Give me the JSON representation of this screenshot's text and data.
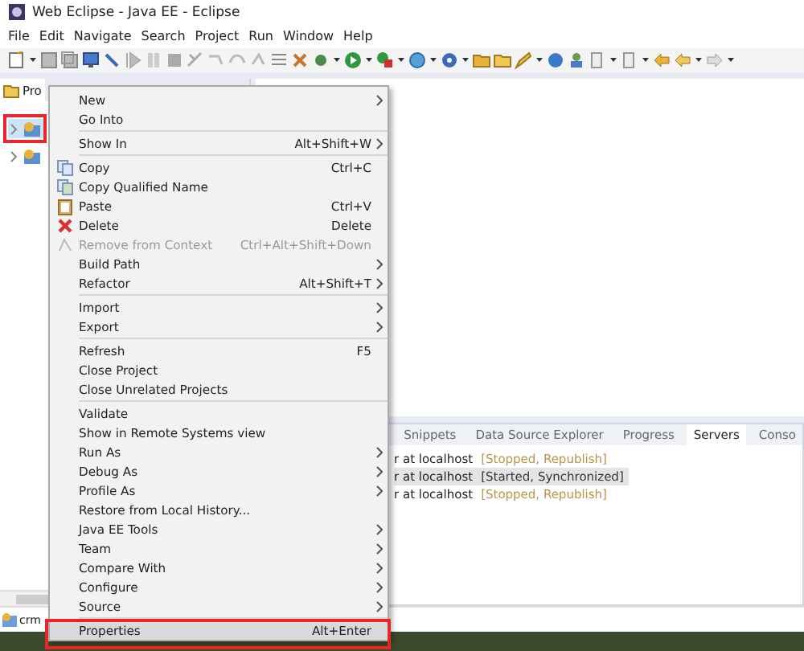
{
  "window": {
    "title": "Web Eclipse - Java EE - Eclipse"
  },
  "menu_bar": [
    "File",
    "Edit",
    "Navigate",
    "Search",
    "Project",
    "Run",
    "Window",
    "Help"
  ],
  "explorer": {
    "tab_label": "Pro",
    "tree": [
      {
        "expanded": false,
        "selected": true
      },
      {
        "expanded": false,
        "selected": false
      }
    ]
  },
  "context_menu": [
    {
      "kind": "item",
      "label": "New",
      "submenu": true,
      "disabled": false,
      "selected": false
    },
    {
      "kind": "item",
      "label": "Go Into",
      "submenu": false,
      "disabled": false,
      "selected": false
    },
    {
      "kind": "separator"
    },
    {
      "kind": "item",
      "label": "Show In",
      "shortcut": "Alt+Shift+W",
      "submenu": true,
      "disabled": false,
      "selected": false
    },
    {
      "kind": "separator"
    },
    {
      "kind": "item",
      "label": "Copy",
      "shortcut": "Ctrl+C",
      "submenu": false,
      "disabled": false,
      "selected": false
    },
    {
      "kind": "item",
      "label": "Copy Qualified Name",
      "submenu": false,
      "disabled": false,
      "selected": false
    },
    {
      "kind": "item",
      "label": "Paste",
      "shortcut": "Ctrl+V",
      "submenu": false,
      "disabled": false,
      "selected": false
    },
    {
      "kind": "item",
      "label": "Delete",
      "shortcut": "Delete",
      "submenu": false,
      "disabled": false,
      "selected": false
    },
    {
      "kind": "item",
      "label": "Remove from Context",
      "shortcut": "Ctrl+Alt+Shift+Down",
      "submenu": false,
      "disabled": true,
      "selected": false
    },
    {
      "kind": "item",
      "label": "Build Path",
      "submenu": true,
      "disabled": false,
      "selected": false
    },
    {
      "kind": "item",
      "label": "Refactor",
      "shortcut": "Alt+Shift+T",
      "submenu": true,
      "disabled": false,
      "selected": false
    },
    {
      "kind": "separator"
    },
    {
      "kind": "item",
      "label": "Import",
      "submenu": true,
      "disabled": false,
      "selected": false
    },
    {
      "kind": "item",
      "label": "Export",
      "submenu": true,
      "disabled": false,
      "selected": false
    },
    {
      "kind": "separator"
    },
    {
      "kind": "item",
      "label": "Refresh",
      "shortcut": "F5",
      "submenu": false,
      "disabled": false,
      "selected": false
    },
    {
      "kind": "item",
      "label": "Close Project",
      "submenu": false,
      "disabled": false,
      "selected": false
    },
    {
      "kind": "item",
      "label": "Close Unrelated Projects",
      "submenu": false,
      "disabled": false,
      "selected": false
    },
    {
      "kind": "separator"
    },
    {
      "kind": "item",
      "label": "Validate",
      "submenu": false,
      "disabled": false,
      "selected": false
    },
    {
      "kind": "item",
      "label": "Show in Remote Systems view",
      "submenu": false,
      "disabled": false,
      "selected": false
    },
    {
      "kind": "item",
      "label": "Run As",
      "submenu": true,
      "disabled": false,
      "selected": false
    },
    {
      "kind": "item",
      "label": "Debug As",
      "submenu": true,
      "disabled": false,
      "selected": false
    },
    {
      "kind": "item",
      "label": "Profile As",
      "submenu": true,
      "disabled": false,
      "selected": false
    },
    {
      "kind": "item",
      "label": "Restore from Local History...",
      "submenu": false,
      "disabled": false,
      "selected": false
    },
    {
      "kind": "item",
      "label": "Java EE Tools",
      "submenu": true,
      "disabled": false,
      "selected": false
    },
    {
      "kind": "item",
      "label": "Team",
      "submenu": true,
      "disabled": false,
      "selected": false
    },
    {
      "kind": "item",
      "label": "Compare With",
      "submenu": true,
      "disabled": false,
      "selected": false
    },
    {
      "kind": "item",
      "label": "Configure",
      "submenu": true,
      "disabled": false,
      "selected": false
    },
    {
      "kind": "item",
      "label": "Source",
      "submenu": true,
      "disabled": false,
      "selected": false
    },
    {
      "kind": "separator"
    },
    {
      "kind": "item",
      "label": "Properties",
      "shortcut": "Alt+Enter",
      "submenu": false,
      "disabled": false,
      "selected": true
    }
  ],
  "bottom_panel": {
    "tabs": [
      {
        "label": "Snippets",
        "selected": false
      },
      {
        "label": "Data Source Explorer",
        "selected": false
      },
      {
        "label": "Progress",
        "selected": false
      },
      {
        "label": "Servers",
        "selected": true
      },
      {
        "label": "Conso",
        "selected": false
      }
    ],
    "rows": [
      {
        "name": "r at localhost",
        "status": "[Stopped, Republish]",
        "color": "#b8954a",
        "selected": false
      },
      {
        "name": "r at localhost",
        "status": "[Started, Synchronized]",
        "color": "#333333",
        "selected": true
      },
      {
        "name": "r at localhost",
        "status": "[Stopped, Republish]",
        "color": "#b8954a",
        "selected": false
      }
    ]
  },
  "status_bar": {
    "text": "crm"
  }
}
